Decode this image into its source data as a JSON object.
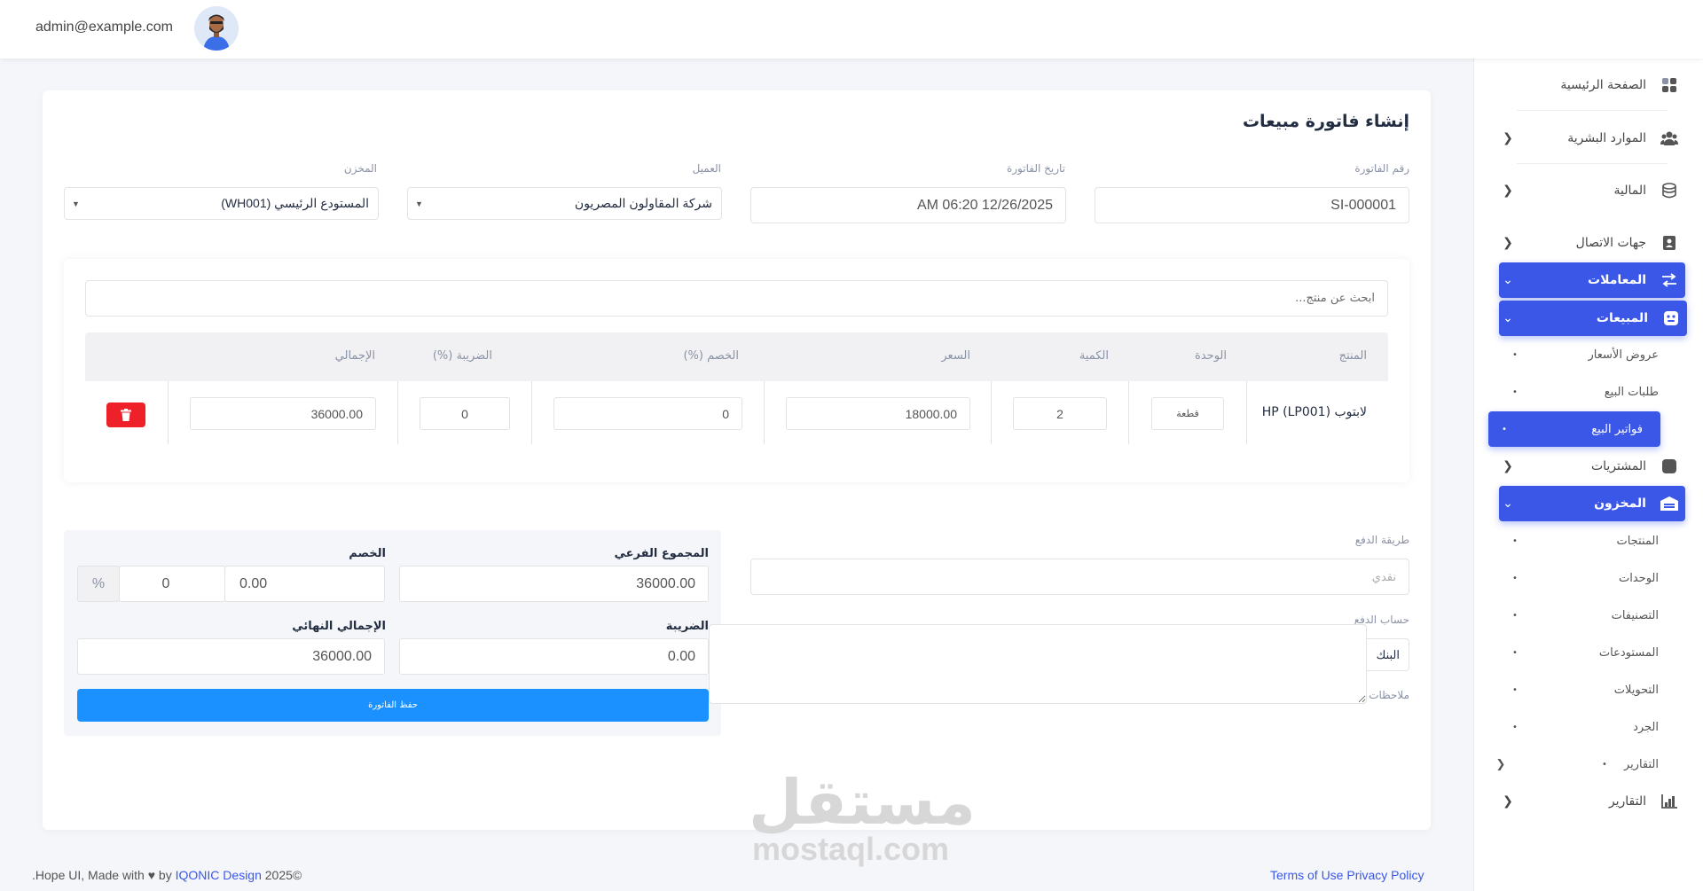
{
  "topbar": {
    "email": "admin@example.com"
  },
  "sidebar": {
    "items": [
      {
        "label": "الصفحة الرئيسية",
        "icon": "grid-icon"
      },
      {
        "label": "الموارد البشرية",
        "icon": "users-icon"
      },
      {
        "label": "المالية",
        "icon": "database-icon"
      },
      {
        "label": "جهات الاتصال",
        "icon": "contact-book-icon"
      },
      {
        "label": "المعاملات",
        "icon": "swap-icon"
      },
      {
        "label": "المبيعات",
        "icon": "sales-icon"
      },
      {
        "label": "المشتريات",
        "icon": "square-icon"
      },
      {
        "label": "المخزون",
        "icon": "warehouse-icon"
      },
      {
        "label": "التقارير",
        "icon": "chart-icon"
      }
    ],
    "sales_sub": [
      "عروض الأسعار",
      "طلبات البيع",
      "فواتير البيع"
    ],
    "inventory_sub": [
      "المنتجات",
      "الوحدات",
      "التصنيفات",
      "المستودعات",
      "التحويلات",
      "الجرد",
      "التقارير"
    ]
  },
  "page": {
    "title": "إنشاء فاتورة مبيعات"
  },
  "form": {
    "invoice_no_label": "رقم الفاتورة",
    "invoice_no": "SI-000001",
    "invoice_date_label": "تاريخ الفاتورة",
    "invoice_date": "12/26/2025 06:20 AM",
    "customer_label": "العميل",
    "customer": "شركة المقاولون المصريون",
    "warehouse_label": "المخزن",
    "warehouse": "المستودع الرئيسي (WH001)"
  },
  "products": {
    "search_placeholder": "ابحث عن منتج...",
    "headers": [
      "المنتج",
      "الوحدة",
      "الكمية",
      "السعر",
      "الخصم (%)",
      "الضريبة (%)",
      "الإجمالي"
    ],
    "row": {
      "product": "لابتوب HP (LP001)",
      "unit": "قطعة",
      "qty": "2",
      "price": "18000.00",
      "discount": "0",
      "tax": "0",
      "total": "36000.00"
    }
  },
  "totals": {
    "subtotal_label": "المجموع الفرعي",
    "subtotal": "36000.00",
    "discount_label": "الخصم",
    "discount_amount": "0.00",
    "discount_value": "0",
    "discount_unit": "%",
    "tax_label": "الضريبة",
    "tax": "0.00",
    "grand_total_label": "الإجمالي النهائي",
    "grand_total": "36000.00",
    "save_label": "حفظ الفاتورة"
  },
  "payment": {
    "method_label": "طريقة الدفع",
    "method_placeholder": "نقدي",
    "account_label": "حساب الدفع",
    "account": "البنك",
    "notes_label": "ملاحظات"
  },
  "footer": {
    "left_prefix": ".Hope UI, Made with ",
    "left_by": " by ",
    "brand": "IQONIC Design",
    "year": " 2025©",
    "terms": "Terms of Use",
    "privacy": "Privacy Policy"
  },
  "watermark": {
    "ar": "مستقل",
    "en": "mostaql.com"
  },
  "colors": {
    "primary": "#3a57e8",
    "save": "#1a91ff",
    "danger": "#ee2029"
  }
}
